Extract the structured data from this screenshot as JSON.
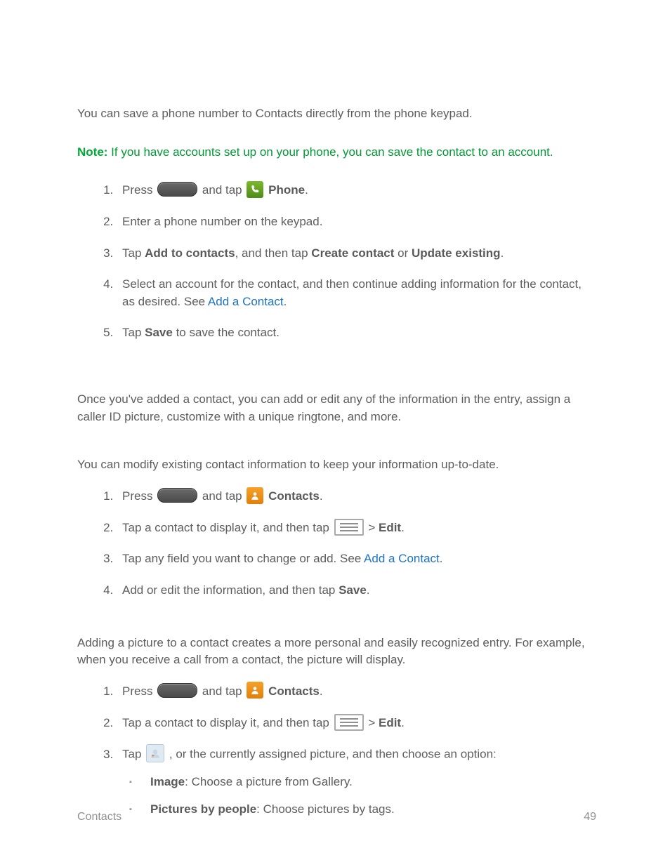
{
  "intro1": "You can save a phone number to Contacts directly from the phone keypad.",
  "note": {
    "label": "Note:",
    "text": " If you have accounts set up on your phone, you can save the contact to an account."
  },
  "list1": {
    "step1": {
      "a": "Press ",
      "b": " and tap ",
      "c": " ",
      "phone": "Phone",
      "d": "."
    },
    "step2": "Enter a phone number on the keypad.",
    "step3": {
      "a": "Tap ",
      "b": "Add to contacts",
      "c": ", and then tap ",
      "d": "Create contact",
      "e": " or ",
      "f": "Update existing",
      "g": "."
    },
    "step4": {
      "a": "Select an account for the contact, and then continue adding information for the contact, as desired. See ",
      "link": "Add a Contact",
      "b": "."
    },
    "step5": {
      "a": "Tap ",
      "b": "Save",
      "c": " to save the contact."
    }
  },
  "intro2": "Once you've added a contact, you can add or edit any of the information in the entry, assign a caller ID picture, customize with a unique ringtone, and more.",
  "intro3": "You can modify existing contact information to keep your information up-to-date.",
  "list2": {
    "step1": {
      "a": "Press ",
      "b": " and tap ",
      "c": " ",
      "contacts": "Contacts",
      "d": "."
    },
    "step2": {
      "a": "Tap a contact to display it, and then tap ",
      "sep": " > ",
      "edit": "Edit",
      "b": "."
    },
    "step3": {
      "a": "Tap any field you want to change or add. See ",
      "link": "Add a Contact",
      "b": "."
    },
    "step4": {
      "a": "Add or edit the information, and then tap ",
      "b": "Save",
      "c": "."
    }
  },
  "intro4": "Adding a picture to a contact creates a more personal and easily recognized entry. For example, when you receive a call from a contact, the picture will display.",
  "list3": {
    "step1": {
      "a": "Press ",
      "b": " and tap ",
      "c": " ",
      "contacts": "Contacts",
      "d": "."
    },
    "step2": {
      "a": "Tap a contact to display it, and then tap ",
      "sep": " > ",
      "edit": "Edit",
      "b": "."
    },
    "step3": {
      "a": "Tap ",
      "b": ", or the currently assigned picture, and then choose an option:"
    },
    "sub1": {
      "a": "Image",
      "b": ": Choose a picture from Gallery."
    },
    "sub2": {
      "a": "Pictures by people",
      "b": ": Choose pictures by tags."
    }
  },
  "footer": {
    "section": "Contacts",
    "page": "49"
  }
}
